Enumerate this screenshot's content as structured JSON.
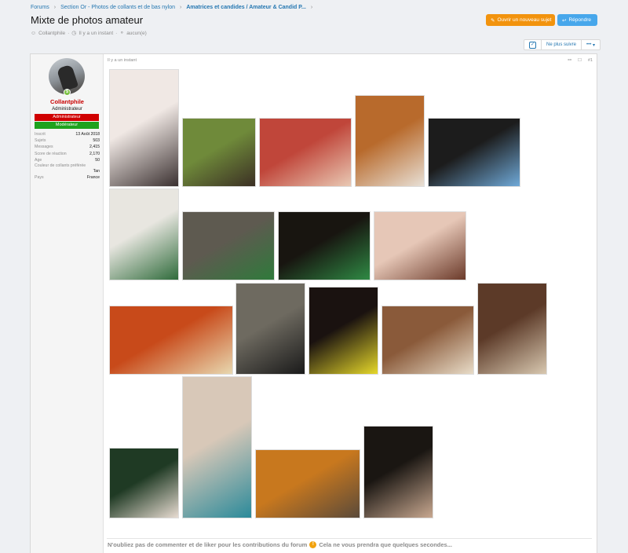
{
  "breadcrumb": [
    {
      "label": "Forums",
      "strong": false
    },
    {
      "label": "Section Or - Photos de collants et de bas nylon",
      "strong": false
    },
    {
      "label": "Amatrices et candides / Amateur & Candid P...",
      "strong": true
    }
  ],
  "thread": {
    "title": "Mixte de photos amateur",
    "author": "Collantphile",
    "time": "Il y a un instant",
    "tags": "aucun(e)"
  },
  "buttons": {
    "new_topic": "Ouvrir un nouveau sujet",
    "reply": "Répondre",
    "unfollow": "Ne plus suivre",
    "more": "•••"
  },
  "user": {
    "name": "Collantphile",
    "title": "Administrateur",
    "banner_admin": "Administrateur",
    "banner_mod": "Modérateur",
    "badge": "$",
    "stats": [
      {
        "label": "Inscrit",
        "value": "13 Août 2018"
      },
      {
        "label": "Sujets",
        "value": "503"
      },
      {
        "label": "Messages",
        "value": "2,415"
      },
      {
        "label": "Score de réaction",
        "value": "2,170"
      },
      {
        "label": "Age",
        "value": "50"
      }
    ],
    "pref_label": "Couleur de collants préférée",
    "pref_value": "Tan",
    "country_label": "Pays",
    "country_value": "France"
  },
  "post": {
    "time": "Il y a un instant",
    "number": "#1",
    "footer": "N'oubliez pas de commenter et de liker pour les contributions du forum",
    "footer_end": "Cela ne vous prendra que quelques secondes..."
  },
  "photos": [
    {
      "c1": "#f0e8e4",
      "c2": "#3a3030"
    },
    {
      "c1": "#6f8a3a",
      "c2": "#3b2f24"
    },
    {
      "c1": "#c0463a",
      "c2": "#e9c9b4"
    },
    {
      "c1": "#b86a2c",
      "c2": "#e8e0d6"
    },
    {
      "c1": "#1c1c1c",
      "c2": "#6fa9d8"
    },
    {
      "c1": "#e8e6e0",
      "c2": "#2f6b3b"
    },
    {
      "c1": "#5e5a50",
      "c2": "#2f7a3b"
    },
    {
      "c1": "#181510",
      "c2": "#2f8a44"
    },
    {
      "c1": "#e6c7b7",
      "c2": "#6b3a2a"
    },
    {
      "c1": "#c84a1a",
      "c2": "#e8d8b0"
    },
    {
      "c1": "#6e6a60",
      "c2": "#1a1a1a"
    },
    {
      "c1": "#1a1210",
      "c2": "#e6d82a"
    },
    {
      "c1": "#8a5a3a",
      "c2": "#e8dcc8"
    },
    {
      "c1": "#5c3a28",
      "c2": "#d8c8b0"
    },
    {
      "c1": "#1f3a24",
      "c2": "#e8dcd2"
    },
    {
      "c1": "#d8c8b8",
      "c2": "#2b8a9a"
    },
    {
      "c1": "#c8781e",
      "c2": "#5a4a3a"
    },
    {
      "c1": "#1a1612",
      "c2": "#c8a890"
    }
  ]
}
